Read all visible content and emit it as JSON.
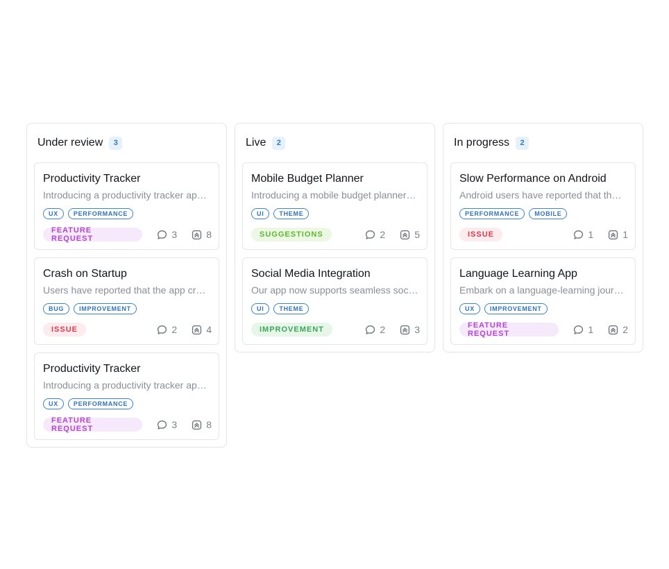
{
  "colors": {
    "feature_request": {
      "bg": "#f6e9fb",
      "fg": "#b247d0"
    },
    "issue": {
      "bg": "#fdecee",
      "fg": "#e0384b"
    },
    "suggestions": {
      "bg": "#ecf8e3",
      "fg": "#5fb82e"
    },
    "improvement": {
      "bg": "#e6f6e9",
      "fg": "#3aa65a"
    }
  },
  "columns": [
    {
      "title": "Under review",
      "count": "3",
      "cards": [
        {
          "title": "Productivity Tracker",
          "description": "Introducing a productivity tracker app to help users manage their time",
          "tags": [
            "UX",
            "PERFORMANCE"
          ],
          "badge": {
            "label": "FEATURE REQUEST",
            "kind": "feature_request"
          },
          "comments": "3",
          "votes": "8"
        },
        {
          "title": "Crash on Startup",
          "description": "Users have reported that the app crashes on startup",
          "tags": [
            "BUG",
            "IMPROVEMENT"
          ],
          "badge": {
            "label": "ISSUE",
            "kind": "issue"
          },
          "comments": "2",
          "votes": "4"
        },
        {
          "title": "Productivity Tracker",
          "description": "Introducing a productivity tracker app to help users manage their time",
          "tags": [
            "UX",
            "PERFORMANCE"
          ],
          "badge": {
            "label": "FEATURE REQUEST",
            "kind": "feature_request"
          },
          "comments": "3",
          "votes": "8"
        }
      ]
    },
    {
      "title": "Live",
      "count": "2",
      "cards": [
        {
          "title": "Mobile Budget Planner",
          "description": "Introducing a mobile budget planner to help users track expenses",
          "tags": [
            "UI",
            "THEME"
          ],
          "badge": {
            "label": "SUGGESTIONS",
            "kind": "suggestions"
          },
          "comments": "2",
          "votes": "5"
        },
        {
          "title": "Social Media Integration",
          "description": "Our app now supports seamless social media sharing",
          "tags": [
            "UI",
            "THEME"
          ],
          "badge": {
            "label": "IMPROVEMENT",
            "kind": "improvement"
          },
          "comments": "2",
          "votes": "3"
        }
      ]
    },
    {
      "title": "In progress",
      "count": "2",
      "cards": [
        {
          "title": "Slow Performance on Android",
          "description": "Android users have reported that the app is slow",
          "tags": [
            "PERFORMANCE",
            "MOBILE"
          ],
          "badge": {
            "label": "ISSUE",
            "kind": "issue"
          },
          "comments": "1",
          "votes": "1"
        },
        {
          "title": "Language Learning App",
          "description": "Embark on a language-learning journey with our new app",
          "tags": [
            "UX",
            "IMPROVEMENT"
          ],
          "badge": {
            "label": "FEATURE REQUEST",
            "kind": "feature_request"
          },
          "comments": "1",
          "votes": "2"
        }
      ]
    }
  ]
}
